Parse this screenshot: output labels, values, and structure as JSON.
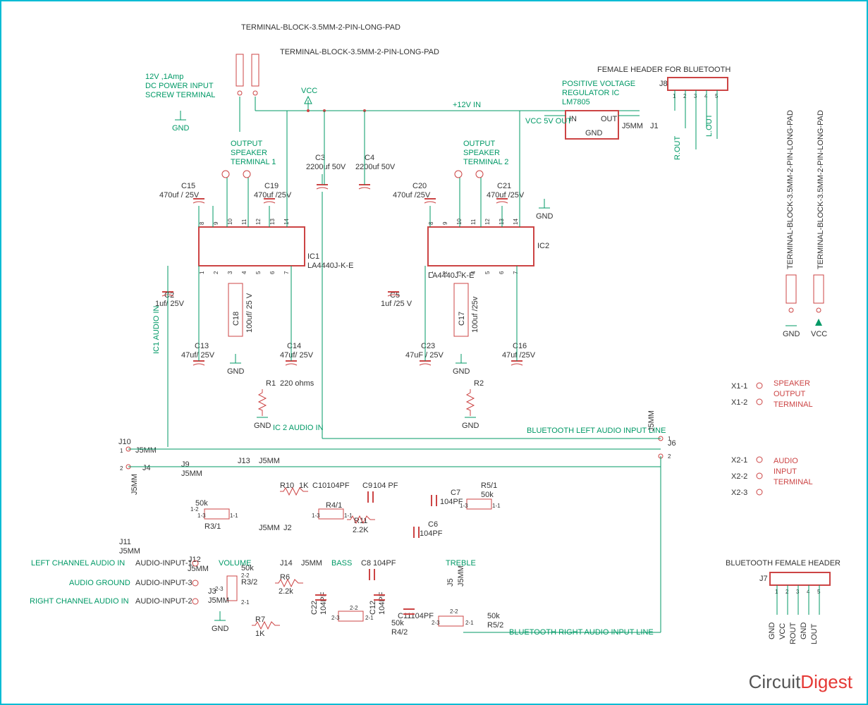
{
  "header": {
    "term1": "TERMINAL-BLOCK-3.5MM-2-PIN-LONG-PAD",
    "term2": "TERMINAL-BLOCK-3.5MM-2-PIN-LONG-PAD",
    "female_header": "FEMALE HEADER FOR BLUETOOTH",
    "right_term1": "TERMINAL-BLOCK-3.5MM-2-PIN-LONG-PAD",
    "right_term2": "TERMINAL-BLOCK-3.5MM-2-PIN-LONG-PAD"
  },
  "power": {
    "line1": "12V ,1Amp",
    "line2": "DC POWER INPUT",
    "line3": "SCREW TERMINAL",
    "gnd": "GND",
    "vcc": "VCC",
    "plus12v": "+12V IN",
    "reg_title1": "POSITIVE VOLTAGE",
    "reg_title2": "REGULATOR IC",
    "reg_title3": "LM7805",
    "reg_in": "IN",
    "reg_out": "OUT",
    "reg_gnd": "GND",
    "vcc5v": "VCC 5V OUT"
  },
  "bluetooth_header": {
    "ref": "J8",
    "rout": "R.OUT",
    "lout": "L.OUT",
    "j1": "J1",
    "j5mm": "J5MM"
  },
  "speakers": {
    "sp1_title1": "OUTPUT",
    "sp1_title2": "SPEAKER",
    "sp1_title3": "TERMINAL 1",
    "sp2_title1": "OUTPUT",
    "sp2_title2": "SPEAKER",
    "sp2_title3": "TERMINAL 2"
  },
  "caps": {
    "c3": "C3",
    "c3v": "2200uf 50V",
    "c4": "C4",
    "c4v": "2200uf 50V",
    "c15": "C15",
    "c15v": "470uf / 25V",
    "c19": "C19",
    "c19v": "470uf /25V",
    "c20": "C20",
    "c20v": "470uf /25V",
    "c21": "C21",
    "c21v": "470uf /25V",
    "c2": "C2",
    "c2v": "1uf/ 25V",
    "c5": "C5",
    "c5v": "1uf /25 V",
    "c18": "C18",
    "c18v": "100uf/ 25 V",
    "c17": "C17",
    "c17v": "100uf /25v",
    "c13": "C13",
    "c13v": "47uf/ 25V",
    "c14": "C14",
    "c14v": "47uf/ 25V",
    "c23": "C23",
    "c23v": "47uF / 25V",
    "c16": "C16",
    "c16v": "47uf /25V",
    "c10": "C10104PF",
    "c9": "C9",
    "c9v": "104 PF",
    "c7": "C7",
    "c7v": "104PF",
    "c6": "C6",
    "c6v": "104PF",
    "c8": "C8",
    "c8v": "104PF",
    "c22": "C22",
    "c22v": "104PF",
    "c12": "C12",
    "c12v": "104PF",
    "c11": "C11104PF"
  },
  "ics": {
    "ic1": "IC1",
    "ic1_part": "LA4440J-K-E",
    "ic2": "IC2",
    "ic2_part": "LA4440J-K-E"
  },
  "resistors": {
    "r1": "R1",
    "r1v": "220 ohms",
    "r2": "R2",
    "r10": "R10",
    "r10v": "1K",
    "r11": "R11",
    "r11v": "2.2K",
    "r6": "R6",
    "r6v": "2.2k",
    "r7": "R7",
    "r7v": "1K",
    "r3_1": "R3/1",
    "r3_2": "R3/2",
    "r4_1": "R4/1",
    "r4_2": "R4/2",
    "r5_1": "R5/1",
    "r5_2": "R5/2",
    "p50k": "50k",
    "r4_2v": "50k"
  },
  "jumpers": {
    "j10": "J10",
    "j4": "J4",
    "j9": "J9",
    "j13": "J13",
    "j11": "J11",
    "j12": "J12",
    "j14": "J14",
    "j2": "J2",
    "j3": "J3",
    "j5": "J5",
    "j6": "J6",
    "j5mm": "J5MM"
  },
  "labels": {
    "ic1_audio_in": "IC1 AUDIO IN",
    "ic2_audio_in": "IC 2 AUDIO IN",
    "bt_left": "BLUETOOTH LEFT AUDIO INPUT LINE",
    "bt_right": "BLUETOOTH RIGHT AUDIO INPUT LINE",
    "volume": "VOLUME",
    "bass": "BASS",
    "treble": "TREBLE",
    "left_ch": "LEFT  CHANNEL  AUDIO IN",
    "audio_gnd": "AUDIO GROUND",
    "right_ch": "RIGHT CHANNEL AUDIO IN",
    "audio_in1": "AUDIO-INPUT-1",
    "audio_in2": "AUDIO-INPUT-2",
    "audio_in3": "AUDIO-INPUT-3"
  },
  "legend": {
    "x1_1": "X1-1",
    "x1_2": "X1-2",
    "speaker_out": "SPEAKER",
    "speaker_out2": "OUTPUT",
    "speaker_out3": "TERMINAL",
    "x2_1": "X2-1",
    "x2_2": "X2-2",
    "x2_3": "X2-3",
    "audio_in1": "AUDIO",
    "audio_in2": "INPUT",
    "audio_in3": "TERMINAL",
    "bt_header": "BLUETOOTH FEMALE HEADER",
    "j7": "J7",
    "gnd": "GND",
    "vcc": "VCC",
    "rout": "ROUT",
    "lout": "LOUT"
  },
  "logo": {
    "part1": "Circuit",
    "part2": "Digest"
  }
}
